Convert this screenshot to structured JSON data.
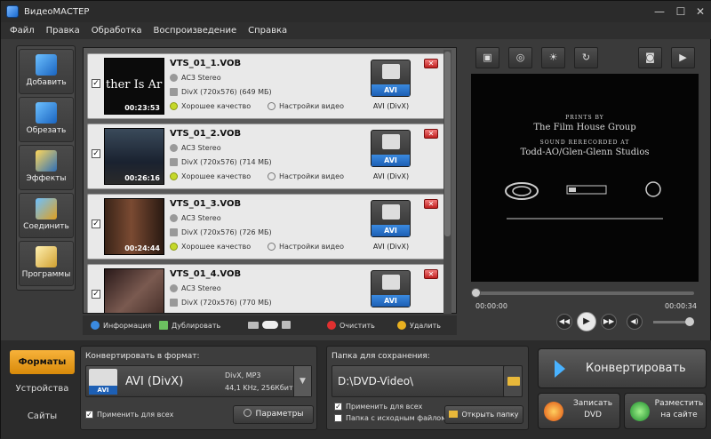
{
  "window": {
    "title": "ВидеоМАСТЕР",
    "minimize": "—",
    "maximize": "☐",
    "close": "✕"
  },
  "menu": [
    "Файл",
    "Правка",
    "Обработка",
    "Воспроизведение",
    "Справка"
  ],
  "sidebar": [
    {
      "label": "Добавить",
      "icon": "add-film-icon",
      "color": "#3a86d6"
    },
    {
      "label": "Обрезать",
      "icon": "scissors-film-icon",
      "color": "#3a86d6"
    },
    {
      "label": "Эффекты",
      "icon": "magic-wand-icon",
      "color": "#2e6fb8"
    },
    {
      "label": "Соединить",
      "icon": "join-films-icon",
      "color": "#3a86d6"
    },
    {
      "label": "Программы",
      "icon": "programs-icon",
      "color": "#e8c860"
    }
  ],
  "files": [
    {
      "name": "VTS_01_1.VOB",
      "duration": "00:23:53",
      "audio": "AC3 Stereo",
      "video": "DivX (720x576) (649 MБ)",
      "quality": "Хорошее качество",
      "settings": "Настройки видео",
      "format_badge": "AVI",
      "format_label": "AVI (DivX)",
      "thumb_text": "ther Is Ar"
    },
    {
      "name": "VTS_01_2.VOB",
      "duration": "00:26:16",
      "audio": "AC3 Stereo",
      "video": "DivX (720x576) (714 MБ)",
      "quality": "Хорошее качество",
      "settings": "Настройки видео",
      "format_badge": "AVI",
      "format_label": "AVI (DivX)"
    },
    {
      "name": "VTS_01_3.VOB",
      "duration": "00:24:44",
      "audio": "AC3 Stereo",
      "video": "DivX (720x576) (726 MБ)",
      "quality": "Хорошее качество",
      "settings": "Настройки видео",
      "format_badge": "AVI",
      "format_label": "AVI (DivX)"
    },
    {
      "name": "VTS_01_4.VOB",
      "duration": "",
      "audio": "AC3 Stereo",
      "video": "DivX (720x576) (770 MБ)",
      "quality": "Хорошее качество",
      "settings": "Настройки видео",
      "format_badge": "AVI",
      "format_label": "AVI (DivX)"
    }
  ],
  "list_toolbar": {
    "info": "Информация",
    "duplicate": "Дублировать",
    "clear": "Очистить",
    "delete": "Удалить"
  },
  "preview": {
    "credits": [
      "PRINTS BY",
      "The Film House Group",
      "SOUND RERECORDED AT",
      "Todd-AO/Glen-Glenn Studios"
    ],
    "time_start": "00:00:00",
    "time_end": "00:00:34",
    "progress": 0.0,
    "volume": 0.9
  },
  "bottom_tabs": [
    {
      "label": "Форматы",
      "active": true
    },
    {
      "label": "Устройства",
      "active": false
    },
    {
      "label": "Сайты",
      "active": false
    }
  ],
  "convert_panel": {
    "label": "Конвертировать в формат:",
    "format_badge": "AVI",
    "format_name": "AVI (DivX)",
    "info1": "DivX, MP3",
    "info2": "44,1 KHz, 256Кбит",
    "apply_all": "Применить для всех",
    "params": "Параметры"
  },
  "save_panel": {
    "label": "Папка для сохранения:",
    "path": "D:\\DVD-Video\\",
    "apply_all": "Применить для всех",
    "source_folder": "Папка с исходным файлом",
    "open_folder": "Открыть папку"
  },
  "actions": {
    "convert": "Конвертировать",
    "burn_dvd_1": "Записать",
    "burn_dvd_2": "DVD",
    "publish_1": "Разместить",
    "publish_2": "на сайте"
  }
}
